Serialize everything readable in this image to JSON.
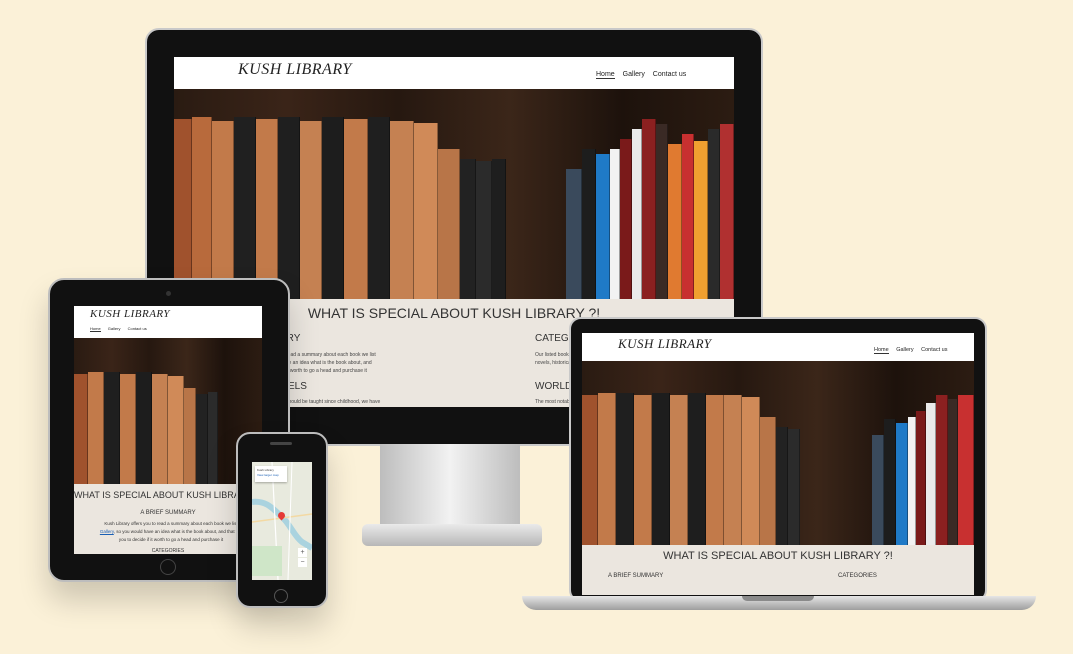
{
  "site": {
    "brand": "KUSH LIBRARY",
    "nav": [
      "Home",
      "Gallery",
      "Contact us"
    ],
    "section_title": "WHAT IS SPECIAL ABOUT KUSH LIBRARY ?!",
    "summary_heading": "A BRIEF SUMMARY",
    "summary_text_1": "Kush Library offers you to read a summary about each book we list",
    "summary_link": "Gallery",
    "summary_text_2": ", so you would have an idea what is the book about, and that will",
    "summary_text_3": "you to decide if it worth to go a head and purchase it",
    "categories_heading": "CATEGORIES",
    "categories_text": "Our listed books",
    "categories_text_2": "novels, historical",
    "novels_heading": "NOVELS",
    "novels_text": "should be taught since childhood, we have",
    "world_heading": "WORLD",
    "world_text": "The most notable",
    "summary_partial": "read a summary about each book we list",
    "summary_partial_2": "ve an idea what is the book about, and",
    "summary_partial_3": "it worth to go a head and purchase it"
  },
  "map": {
    "place": "Kush Library",
    "link": "View larger map"
  },
  "colors": {
    "background": "#fbf1d8",
    "device_frame": "#1a1a1a",
    "section_bg": "#ebe6df",
    "link": "#1a5fb4"
  }
}
